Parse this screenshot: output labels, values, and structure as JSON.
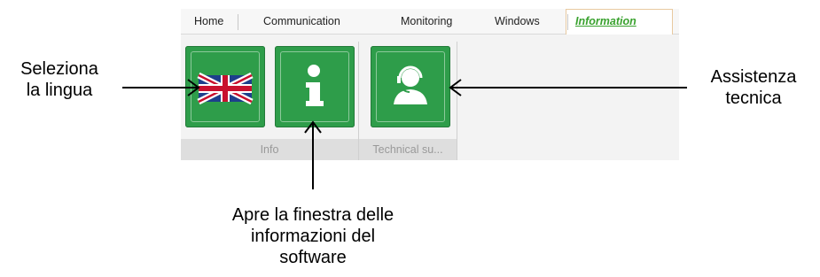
{
  "ribbon": {
    "tabs": [
      {
        "label": "Home"
      },
      {
        "label": "Communication"
      },
      {
        "label": "Monitoring"
      },
      {
        "label": "Windows"
      },
      {
        "label": "Information",
        "active": true
      }
    ],
    "groups": [
      {
        "label": "Info",
        "buttons": [
          {
            "icon": "uk-flag-icon"
          },
          {
            "icon": "info-icon"
          }
        ]
      },
      {
        "label": "Technical su...",
        "buttons": [
          {
            "icon": "support-agent-icon"
          }
        ]
      }
    ],
    "colors": {
      "button_green": "#2e9d4a",
      "active_tab_text": "#3aa22f"
    }
  },
  "annotations": {
    "language": {
      "line1": "Seleziona",
      "line2": "la lingua"
    },
    "support": {
      "line1": "Assistenza",
      "line2": "tecnica"
    },
    "info": {
      "line1": "Apre la finestra delle",
      "line2": "informazioni del",
      "line3": "software"
    }
  }
}
